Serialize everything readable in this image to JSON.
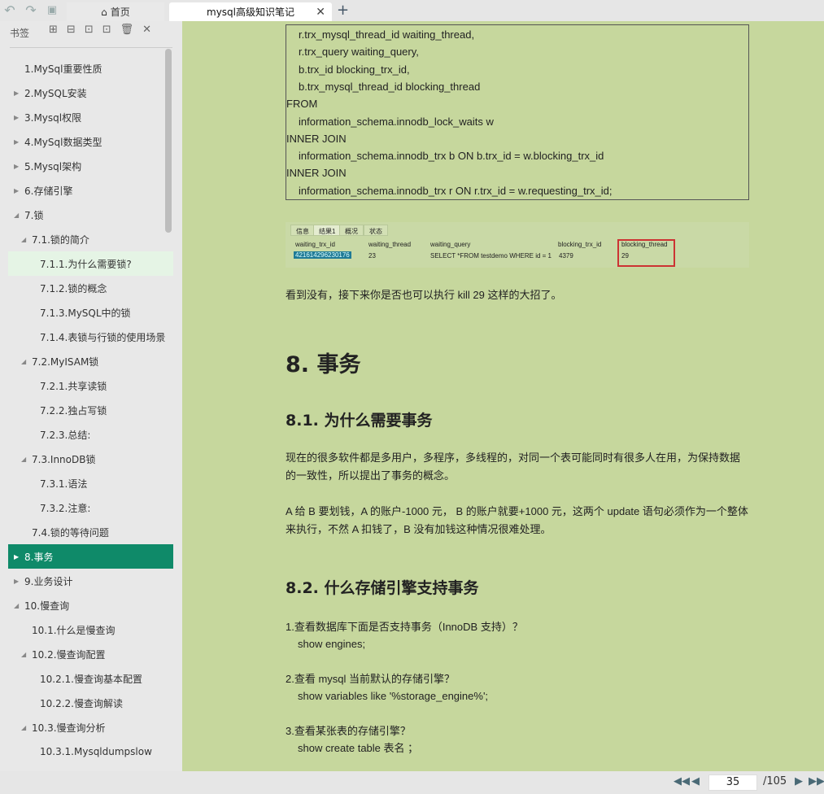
{
  "toolbar": {
    "undo": "↶",
    "redo": "↷",
    "save": "💾"
  },
  "tabs": [
    {
      "label": "首页",
      "icon": "home-icon"
    },
    {
      "label": "mysql高级知识笔记",
      "close": "✕"
    }
  ],
  "tab_add": "+",
  "sidebar": {
    "title": "书签",
    "tools": [
      "⊞",
      "⊟",
      "⊡",
      "⊡",
      "🗑",
      "✕"
    ],
    "items": [
      {
        "label": "1.MySql重要性质",
        "level": 0,
        "state": "none"
      },
      {
        "label": "2.MySQL安装",
        "level": 0,
        "state": "collapsed"
      },
      {
        "label": "3.Mysql权限",
        "level": 0,
        "state": "collapsed"
      },
      {
        "label": "4.MySql数据类型",
        "level": 0,
        "state": "collapsed"
      },
      {
        "label": "5.Mysql架构",
        "level": 0,
        "state": "collapsed"
      },
      {
        "label": "6.存储引擎",
        "level": 0,
        "state": "collapsed"
      },
      {
        "label": "7.锁",
        "level": 0,
        "state": "expanded"
      },
      {
        "label": "7.1.锁的简介",
        "level": 1,
        "state": "expanded"
      },
      {
        "label": "7.1.1.为什么需要锁?",
        "level": 2,
        "state": "none",
        "highlight": true
      },
      {
        "label": "7.1.2.锁的概念",
        "level": 2,
        "state": "none"
      },
      {
        "label": "7.1.3.MySQL中的锁",
        "level": 2,
        "state": "none"
      },
      {
        "label": "7.1.4.表锁与行锁的使用场景",
        "level": 2,
        "state": "none"
      },
      {
        "label": "7.2.MyISAM锁",
        "level": 1,
        "state": "expanded"
      },
      {
        "label": "7.2.1.共享读锁",
        "level": 2,
        "state": "none"
      },
      {
        "label": "7.2.2.独占写锁",
        "level": 2,
        "state": "none"
      },
      {
        "label": "7.2.3.总结:",
        "level": 2,
        "state": "none"
      },
      {
        "label": "7.3.InnoDB锁",
        "level": 1,
        "state": "expanded"
      },
      {
        "label": "7.3.1.语法",
        "level": 2,
        "state": "none"
      },
      {
        "label": "7.3.2.注意:",
        "level": 2,
        "state": "none"
      },
      {
        "label": "7.4.锁的等待问题",
        "level": 1,
        "state": "none"
      },
      {
        "label": "8.事务",
        "level": 0,
        "state": "collapsed",
        "selected": true
      },
      {
        "label": "9.业务设计",
        "level": 0,
        "state": "collapsed"
      },
      {
        "label": "10.慢查询",
        "level": 0,
        "state": "expanded"
      },
      {
        "label": "10.1.什么是慢查询",
        "level": 1,
        "state": "none"
      },
      {
        "label": "10.2.慢查询配置",
        "level": 1,
        "state": "expanded"
      },
      {
        "label": "10.2.1.慢查询基本配置",
        "level": 2,
        "state": "none"
      },
      {
        "label": "10.2.2.慢查询解读",
        "level": 2,
        "state": "none"
      },
      {
        "label": "10.3.慢查询分析",
        "level": 1,
        "state": "expanded"
      },
      {
        "label": "10.3.1.Mysqldumpslow",
        "level": 2,
        "state": "none"
      }
    ]
  },
  "code_lines": [
    {
      "text": "r.trx_mysql_thread_id waiting_thread,",
      "indent": true
    },
    {
      "text": "r.trx_query waiting_query,",
      "indent": true
    },
    {
      "text": "b.trx_id blocking_trx_id,",
      "indent": true
    },
    {
      "text": "b.trx_mysql_thread_id blocking_thread",
      "indent": true
    },
    {
      "text": "FROM",
      "indent": false
    },
    {
      "text": "information_schema.innodb_lock_waits w",
      "indent": true
    },
    {
      "text": "INNER JOIN",
      "indent": false
    },
    {
      "text": "information_schema.innodb_trx b ON b.trx_id = w.blocking_trx_id",
      "indent": true
    },
    {
      "text": "INNER JOIN",
      "indent": false
    },
    {
      "text": "information_schema.innodb_trx r ON r.trx_id = w.requesting_trx_id;",
      "indent": true
    }
  ],
  "result_shot": {
    "tabs": [
      "信息",
      "结果1",
      "概况",
      "状态"
    ],
    "headers": [
      "waiting_trx_id",
      "waiting_thread",
      "waiting_query",
      "blocking_trx_id",
      "blocking_thread"
    ],
    "row": [
      "421614296230176",
      "23",
      "SELECT *FROM testdemo WHERE id = 1",
      "4379",
      "29"
    ]
  },
  "content": {
    "p1": "看到没有，接下来你是否也可以执行 kill 29  这样的大招了。",
    "h1": "8. 事务",
    "h2a": "8.1. 为什么需要事务",
    "p2": "现在的很多软件都是多用户，多程序，多线程的，对同一个表可能同时有很多人在用，为保持数据的一致性，所以提出了事务的概念。",
    "p3": "A  给 B  要划钱，A  的账户-1000 元，  B  的账户就要+1000 元，这两个 update  语句必须作为一个整体来执行，不然 A  扣钱了，B  没有加钱这种情况很难处理。",
    "h2b": "8.2. 什么存储引擎支持事务",
    "s1": "1.查看数据库下面是否支持事务（InnoDB 支持）？",
    "s1c": "show engines;",
    "s2": "2.查看 mysql 当前默认的存储引擎？",
    "s2c": "show variables like '%storage_engine%';",
    "s3": "3.查看某张表的存储引擎？",
    "s3c": "show create table  表名 ；"
  },
  "pager": {
    "first": "⏮",
    "prev": "◀",
    "current": "35",
    "total": "/105",
    "next": "▶",
    "last": "⏭"
  },
  "colors": {
    "content_bg": "#c6d79d",
    "selected": "#0f8a69",
    "highlight": "#e5f4e5"
  }
}
